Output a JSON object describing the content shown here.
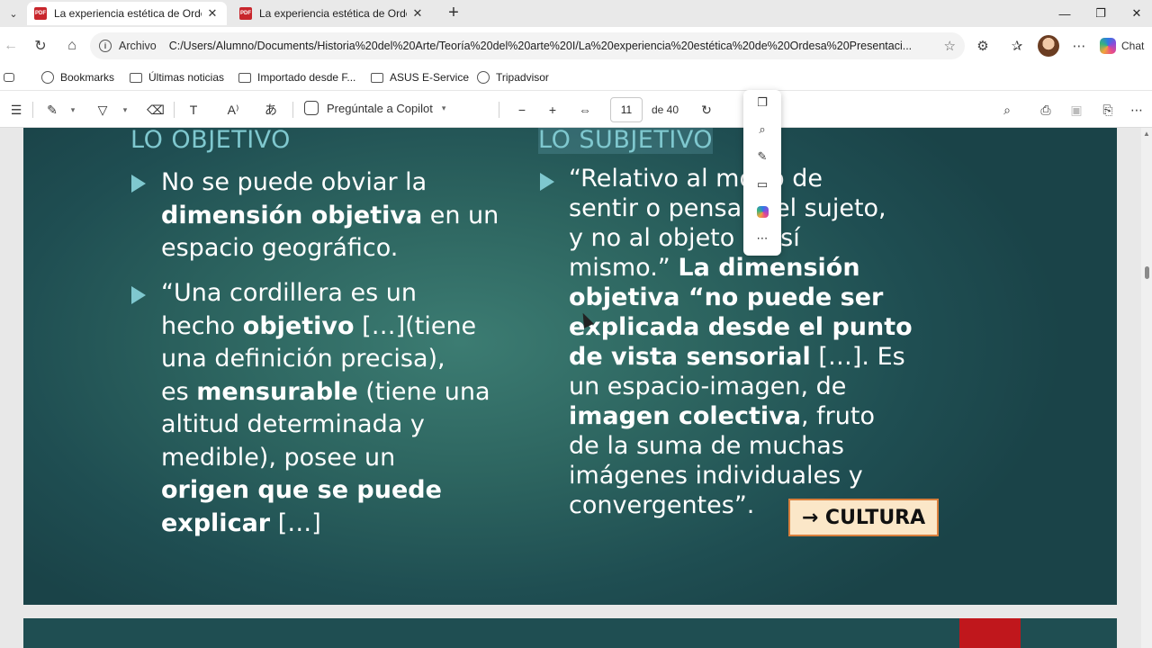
{
  "tabs": [
    {
      "title": "La experiencia estética de Ordesa P",
      "active": true
    },
    {
      "title": "La experiencia estética de Ordesa P",
      "active": false
    }
  ],
  "address": {
    "scheme_label": "Archivo",
    "url": "C:/Users/Alumno/Documents/Historia%20del%20Arte/Teoría%20del%20arte%20I/La%20experiencia%20estética%20de%20Ordesa%20Presentaci..."
  },
  "chat_label": "Chat",
  "bookmarks": [
    {
      "label": "Bookmarks",
      "icon": "bookmarks-icon"
    },
    {
      "label": "Últimas noticias",
      "icon": "folder-icon"
    },
    {
      "label": "Importado desde F...",
      "icon": "folder-icon"
    },
    {
      "label": "ASUS E-Service",
      "icon": "folder-icon"
    },
    {
      "label": "Tripadvisor",
      "icon": "globe-icon"
    }
  ],
  "pdf_toolbar": {
    "ask_copilot": "Pregúntale a Copilot",
    "current_page": "11",
    "total_pages": "de 40"
  },
  "slide": {
    "left_heading": "LO OBJETIVO",
    "right_heading": "LO SUBJETIVO",
    "left_bullet_1": {
      "l1": "No se puede obviar la",
      "l2_bold": "dimensión objetiva",
      "l2_rest": " en un",
      "l3": "espacio geográfico."
    },
    "left_bullet_2": {
      "l1": "“Una cordillera es un",
      "l2_pre": "hecho ",
      "l2_bold": "objetivo",
      "l2_rest": " […](tiene",
      "l3": "una definición precisa),",
      "l4_pre": "es ",
      "l4_bold": "mensurable",
      "l4_rest": " (tiene una",
      "l5": "altitud determinada y",
      "l6": "medible), posee un",
      "l7_bold": "origen que se puede",
      "l8_bold": "explicar",
      "l8_rest": " […]"
    },
    "right_bullet": {
      "l1": "“Relativo al modo de",
      "l2": "sentir o pensar del sujeto,",
      "l3": "y no al objeto en sí",
      "l4_pre": "mismo.” ",
      "l4_bold": "La dimensión",
      "l5_bold": "objetiva “no puede ser",
      "l6_bold": "explicada desde el punto",
      "l7_bold": "de vista sensorial",
      "l7_rest": " […]. Es",
      "l8": "un espacio-imagen, de",
      "l9_bold": "imagen colectiva",
      "l9_rest": ", fruto",
      "l10": "de la suma de muchas",
      "l11": "imágenes individuales y",
      "l12": "convergentes”."
    },
    "cultura_button": "→ CULTURA"
  }
}
